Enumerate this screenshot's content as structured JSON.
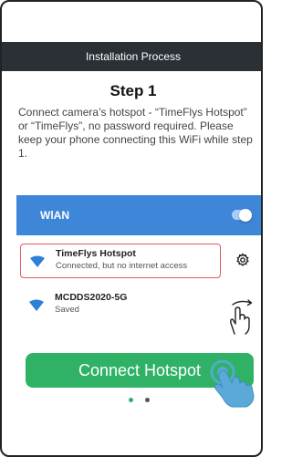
{
  "header": {
    "title": "Installation Process"
  },
  "step": {
    "title": "Step 1",
    "description": "Connect camera’s hotspot - “TimeFlys Hotspot” or “TimeFlys”, no password required. Please keep your phone connecting this WiFi while step 1."
  },
  "wlan": {
    "label": "WlAN",
    "toggle_on": true
  },
  "networks": [
    {
      "name": "TimeFlys Hotspot",
      "status": "Connected, but no internet access",
      "highlighted": true,
      "icon": "wifi-icon"
    },
    {
      "name": "MCDDS2020-5G",
      "status": "Saved",
      "highlighted": false,
      "icon": "wifi-icon"
    }
  ],
  "connect_button": {
    "label": "Connect Hotspot"
  },
  "pager": {
    "active_index": 0,
    "count": 2
  },
  "colors": {
    "header_bg": "#2b2f36",
    "wlan_bar": "#3e86d8",
    "wifi_icon": "#2e7fd6",
    "highlight_border": "#e05a5a",
    "button_green": "#2fb266",
    "dot_active": "#2fb266",
    "dot_inactive": "#555555",
    "tap_hand": "#5aa9d9"
  }
}
